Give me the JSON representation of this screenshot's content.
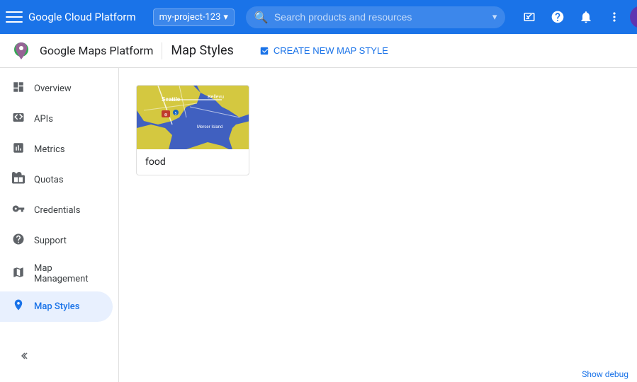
{
  "topbar": {
    "title": "Google Cloud Platform",
    "project_name": "my-project-123",
    "search_placeholder": "Search products and resources"
  },
  "subheader": {
    "brand": "Google Maps Platform",
    "page_title": "Map Styles",
    "create_btn_label": "CREATE NEW MAP STYLE"
  },
  "sidebar": {
    "items": [
      {
        "id": "overview",
        "label": "Overview",
        "icon": "☰"
      },
      {
        "id": "apis",
        "label": "APIs",
        "icon": "⊞"
      },
      {
        "id": "metrics",
        "label": "Metrics",
        "icon": "▦"
      },
      {
        "id": "quotas",
        "label": "Quotas",
        "icon": "▣"
      },
      {
        "id": "credentials",
        "label": "Credentials",
        "icon": "⚷"
      },
      {
        "id": "support",
        "label": "Support",
        "icon": "👤"
      },
      {
        "id": "map-management",
        "label": "Map Management",
        "icon": "⊟"
      },
      {
        "id": "map-styles",
        "label": "Map Styles",
        "icon": "⊙",
        "active": true
      }
    ]
  },
  "map_styles": [
    {
      "id": "food",
      "label": "food"
    }
  ],
  "debug_label": "Show debug"
}
